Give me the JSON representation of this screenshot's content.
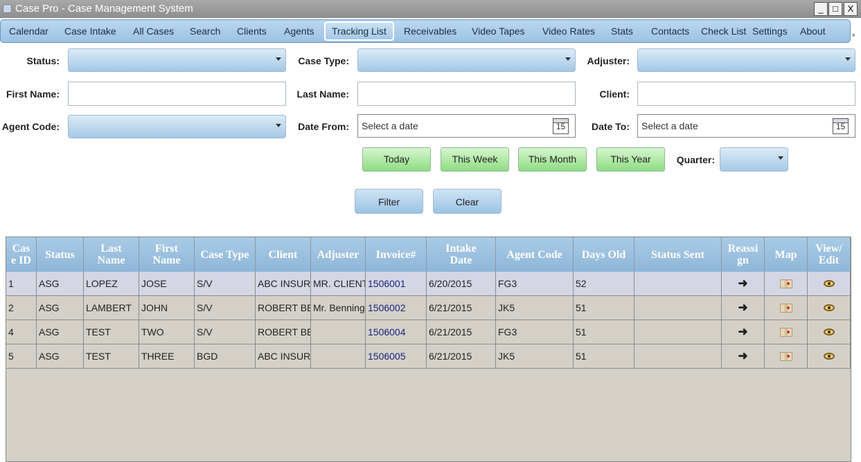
{
  "window": {
    "title": "Case Pro - Case Management System",
    "min": "_",
    "max": "□",
    "close": "X"
  },
  "menu": [
    "Calendar",
    "Case Intake",
    "All Cases",
    "Search",
    "Clients",
    "Agents",
    "Tracking List",
    "Receivables",
    "Video Tapes",
    "Video Rates",
    "Stats",
    "Contacts",
    "Check List",
    "Settings",
    "About"
  ],
  "menu_active": "Tracking List",
  "filters": {
    "status_label": "Status:",
    "case_type_label": "Case Type:",
    "adjuster_label": "Adjuster:",
    "first_name_label": "First Name:",
    "last_name_label": "Last Name:",
    "client_label": "Client:",
    "agent_code_label": "Agent Code:",
    "date_from_label": "Date From:",
    "date_to_label": "Date To:",
    "date_placeholder": "Select a date",
    "calendar_day": "15",
    "quarter_label": "Quarter:"
  },
  "quick_buttons": {
    "today": "Today",
    "week": "This Week",
    "month": "This Month",
    "year": "This Year"
  },
  "actions": {
    "filter": "Filter",
    "clear": "Clear"
  },
  "columns": [
    "Case ID",
    "Status",
    "Last Name",
    "First Name",
    "Case Type",
    "Client",
    "Adjuster",
    "Invoice#",
    "Intake Date",
    "Agent Code",
    "Days Old",
    "Status Sent",
    "Reassign",
    "Map",
    "View/ Edit"
  ],
  "column_header_display": [
    "Cas\ne ID",
    "Status",
    "Last\nName",
    "First\nName",
    "Case Type",
    "Client",
    "Adjuster",
    "Invoice#",
    "Intake\nDate",
    "Agent Code",
    "Days Old",
    "Status Sent",
    "Reassi\ngn",
    "Map",
    "View/\nEdit"
  ],
  "rows": [
    {
      "case_id": "1",
      "status": "ASG",
      "last": "LOPEZ",
      "first": "JOSE",
      "type": "S/V",
      "client": "ABC INSURANCE",
      "adjuster": "MR. CLIENT",
      "invoice": "1506001",
      "intake": "6/20/2015",
      "agent": "FG3",
      "days": "52",
      "sent": ""
    },
    {
      "case_id": "2",
      "status": "ASG",
      "last": "LAMBERT",
      "first": "JOHN",
      "type": "S/V",
      "client": "ROBERT BENNING",
      "adjuster": "Mr. Benning",
      "invoice": "1506002",
      "intake": "6/21/2015",
      "agent": "JK5",
      "days": "51",
      "sent": ""
    },
    {
      "case_id": "4",
      "status": "ASG",
      "last": "TEST",
      "first": "TWO",
      "type": "S/V",
      "client": "ROBERT BENNING",
      "adjuster": "",
      "invoice": "1506004",
      "intake": "6/21/2015",
      "agent": "FG3",
      "days": "51",
      "sent": ""
    },
    {
      "case_id": "5",
      "status": "ASG",
      "last": "TEST",
      "first": "THREE",
      "type": "BGD",
      "client": "ABC INSURANCE",
      "adjuster": "",
      "invoice": "1506005",
      "intake": "6/21/2015",
      "agent": "JK5",
      "days": "51",
      "sent": ""
    }
  ],
  "icons": {
    "reassign": "arrow-icon",
    "map": "map-icon",
    "view": "eye-icon"
  },
  "colors": {
    "header": "#9fc3e2",
    "selected_row": "#d5d6e4",
    "row": "#d4d0c8",
    "link": "#1a237e",
    "green_button": "#a8e59d"
  }
}
